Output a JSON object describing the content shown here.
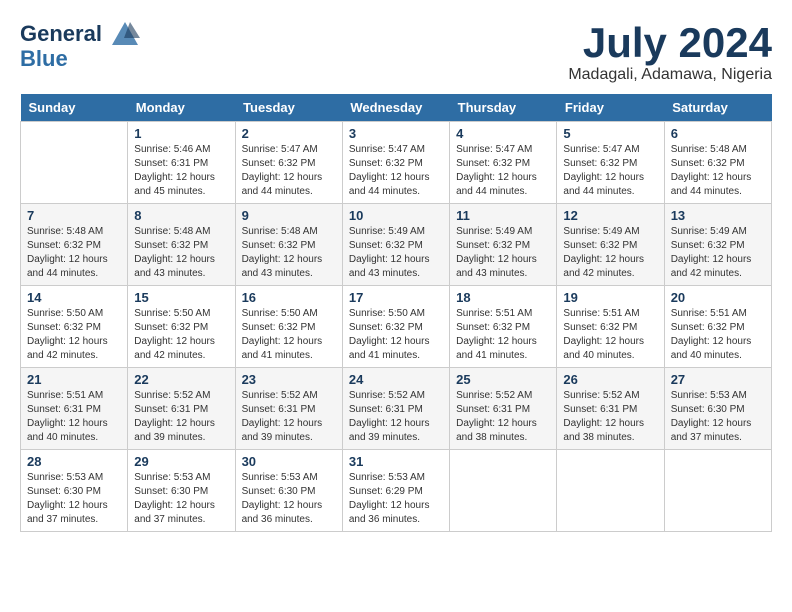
{
  "header": {
    "logo_line1": "General",
    "logo_line2": "Blue",
    "month_title": "July 2024",
    "location": "Madagali, Adamawa, Nigeria"
  },
  "days_of_week": [
    "Sunday",
    "Monday",
    "Tuesday",
    "Wednesday",
    "Thursday",
    "Friday",
    "Saturday"
  ],
  "weeks": [
    [
      {
        "day": "",
        "info": ""
      },
      {
        "day": "1",
        "info": "Sunrise: 5:46 AM\nSunset: 6:31 PM\nDaylight: 12 hours\nand 45 minutes."
      },
      {
        "day": "2",
        "info": "Sunrise: 5:47 AM\nSunset: 6:32 PM\nDaylight: 12 hours\nand 44 minutes."
      },
      {
        "day": "3",
        "info": "Sunrise: 5:47 AM\nSunset: 6:32 PM\nDaylight: 12 hours\nand 44 minutes."
      },
      {
        "day": "4",
        "info": "Sunrise: 5:47 AM\nSunset: 6:32 PM\nDaylight: 12 hours\nand 44 minutes."
      },
      {
        "day": "5",
        "info": "Sunrise: 5:47 AM\nSunset: 6:32 PM\nDaylight: 12 hours\nand 44 minutes."
      },
      {
        "day": "6",
        "info": "Sunrise: 5:48 AM\nSunset: 6:32 PM\nDaylight: 12 hours\nand 44 minutes."
      }
    ],
    [
      {
        "day": "7",
        "info": "Sunrise: 5:48 AM\nSunset: 6:32 PM\nDaylight: 12 hours\nand 44 minutes."
      },
      {
        "day": "8",
        "info": "Sunrise: 5:48 AM\nSunset: 6:32 PM\nDaylight: 12 hours\nand 43 minutes."
      },
      {
        "day": "9",
        "info": "Sunrise: 5:48 AM\nSunset: 6:32 PM\nDaylight: 12 hours\nand 43 minutes."
      },
      {
        "day": "10",
        "info": "Sunrise: 5:49 AM\nSunset: 6:32 PM\nDaylight: 12 hours\nand 43 minutes."
      },
      {
        "day": "11",
        "info": "Sunrise: 5:49 AM\nSunset: 6:32 PM\nDaylight: 12 hours\nand 43 minutes."
      },
      {
        "day": "12",
        "info": "Sunrise: 5:49 AM\nSunset: 6:32 PM\nDaylight: 12 hours\nand 42 minutes."
      },
      {
        "day": "13",
        "info": "Sunrise: 5:49 AM\nSunset: 6:32 PM\nDaylight: 12 hours\nand 42 minutes."
      }
    ],
    [
      {
        "day": "14",
        "info": "Sunrise: 5:50 AM\nSunset: 6:32 PM\nDaylight: 12 hours\nand 42 minutes."
      },
      {
        "day": "15",
        "info": "Sunrise: 5:50 AM\nSunset: 6:32 PM\nDaylight: 12 hours\nand 42 minutes."
      },
      {
        "day": "16",
        "info": "Sunrise: 5:50 AM\nSunset: 6:32 PM\nDaylight: 12 hours\nand 41 minutes."
      },
      {
        "day": "17",
        "info": "Sunrise: 5:50 AM\nSunset: 6:32 PM\nDaylight: 12 hours\nand 41 minutes."
      },
      {
        "day": "18",
        "info": "Sunrise: 5:51 AM\nSunset: 6:32 PM\nDaylight: 12 hours\nand 41 minutes."
      },
      {
        "day": "19",
        "info": "Sunrise: 5:51 AM\nSunset: 6:32 PM\nDaylight: 12 hours\nand 40 minutes."
      },
      {
        "day": "20",
        "info": "Sunrise: 5:51 AM\nSunset: 6:32 PM\nDaylight: 12 hours\nand 40 minutes."
      }
    ],
    [
      {
        "day": "21",
        "info": "Sunrise: 5:51 AM\nSunset: 6:31 PM\nDaylight: 12 hours\nand 40 minutes."
      },
      {
        "day": "22",
        "info": "Sunrise: 5:52 AM\nSunset: 6:31 PM\nDaylight: 12 hours\nand 39 minutes."
      },
      {
        "day": "23",
        "info": "Sunrise: 5:52 AM\nSunset: 6:31 PM\nDaylight: 12 hours\nand 39 minutes."
      },
      {
        "day": "24",
        "info": "Sunrise: 5:52 AM\nSunset: 6:31 PM\nDaylight: 12 hours\nand 39 minutes."
      },
      {
        "day": "25",
        "info": "Sunrise: 5:52 AM\nSunset: 6:31 PM\nDaylight: 12 hours\nand 38 minutes."
      },
      {
        "day": "26",
        "info": "Sunrise: 5:52 AM\nSunset: 6:31 PM\nDaylight: 12 hours\nand 38 minutes."
      },
      {
        "day": "27",
        "info": "Sunrise: 5:53 AM\nSunset: 6:30 PM\nDaylight: 12 hours\nand 37 minutes."
      }
    ],
    [
      {
        "day": "28",
        "info": "Sunrise: 5:53 AM\nSunset: 6:30 PM\nDaylight: 12 hours\nand 37 minutes."
      },
      {
        "day": "29",
        "info": "Sunrise: 5:53 AM\nSunset: 6:30 PM\nDaylight: 12 hours\nand 37 minutes."
      },
      {
        "day": "30",
        "info": "Sunrise: 5:53 AM\nSunset: 6:30 PM\nDaylight: 12 hours\nand 36 minutes."
      },
      {
        "day": "31",
        "info": "Sunrise: 5:53 AM\nSunset: 6:29 PM\nDaylight: 12 hours\nand 36 minutes."
      },
      {
        "day": "",
        "info": ""
      },
      {
        "day": "",
        "info": ""
      },
      {
        "day": "",
        "info": ""
      }
    ]
  ]
}
